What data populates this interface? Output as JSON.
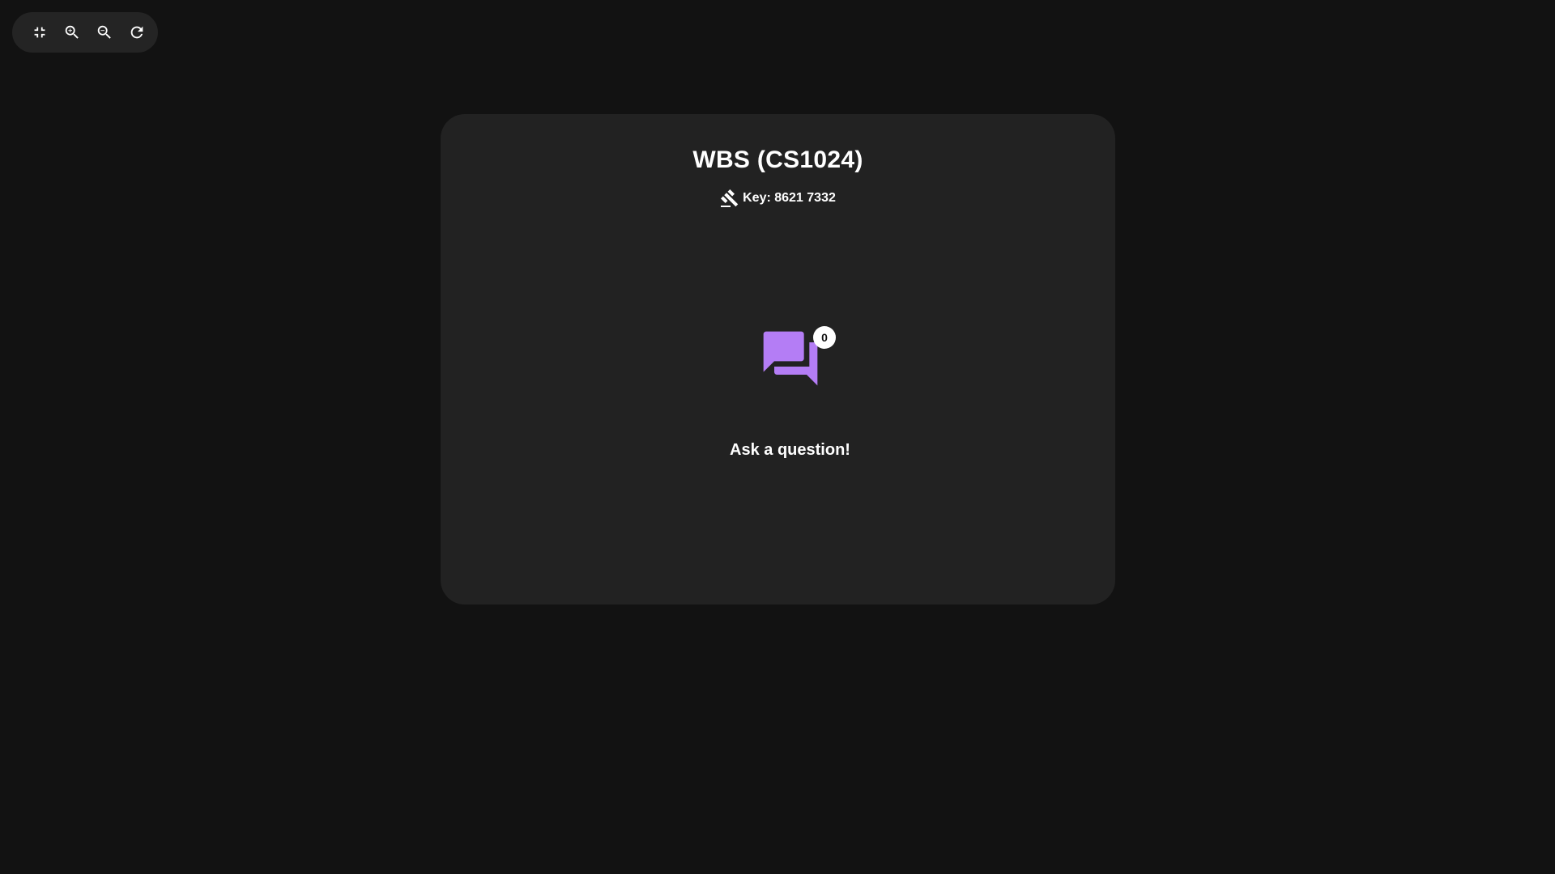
{
  "toolbar": {
    "buttons": [
      {
        "icon": "collapse-icon"
      },
      {
        "icon": "zoom-in-icon"
      },
      {
        "icon": "zoom-out-icon"
      },
      {
        "icon": "refresh-icon"
      }
    ]
  },
  "card": {
    "title": "WBS (CS1024)",
    "key_label": "Key: 8621 7332",
    "key_icon": "gavel-icon",
    "chat_icon": "forum-icon",
    "question_count": "0",
    "ask_label": "Ask a question!"
  },
  "colors": {
    "background": "#121212",
    "card": "#222222",
    "accent": "#b47df5"
  }
}
